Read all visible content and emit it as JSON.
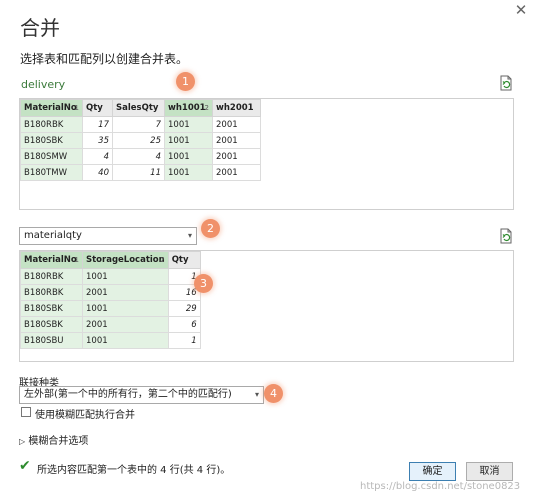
{
  "dialog": {
    "title": "合并",
    "subtitle": "选择表和匹配列以创建合并表。",
    "close_icon": "close-icon"
  },
  "table1": {
    "name": "delivery",
    "columns": [
      {
        "name": "MaterialNo",
        "index": "1"
      },
      {
        "name": "Qty",
        "index": ""
      },
      {
        "name": "SalesQty",
        "index": ""
      },
      {
        "name": "wh1001",
        "index": "2"
      },
      {
        "name": "wh2001",
        "index": ""
      }
    ],
    "rows": [
      [
        "B180RBK",
        "17",
        "7",
        "1001",
        "2001"
      ],
      [
        "B180SBK",
        "35",
        "25",
        "1001",
        "2001"
      ],
      [
        "B180SMW",
        "4",
        "4",
        "1001",
        "2001"
      ],
      [
        "B180TMW",
        "40",
        "11",
        "1001",
        "2001"
      ]
    ]
  },
  "table2": {
    "selected": "materialqty",
    "columns": [
      {
        "name": "MaterialNo",
        "index": "1"
      },
      {
        "name": "StorageLocation",
        "index": "2"
      },
      {
        "name": "Qty",
        "index": ""
      }
    ],
    "rows": [
      [
        "B180RBK",
        "1001",
        "1"
      ],
      [
        "B180RBK",
        "2001",
        "16"
      ],
      [
        "B180SBK",
        "1001",
        "29"
      ],
      [
        "B180SBK",
        "2001",
        "6"
      ],
      [
        "B180SBU",
        "1001",
        "1"
      ]
    ]
  },
  "join": {
    "label": "联接种类",
    "selected": "左外部(第一个中的所有行，第二个中的匹配行)",
    "fuzzy_label": "使用模糊匹配执行合并",
    "fuzzy_checked": false,
    "fuzzy_options_label": "模糊合并选项"
  },
  "status": {
    "text": "所选内容匹配第一个表中的 4 行(共 4 行)。"
  },
  "buttons": {
    "ok": "确定",
    "cancel": "取消"
  },
  "badges": [
    "1",
    "2",
    "3",
    "4"
  ],
  "watermark": "https://blog.csdn.net/stone0823",
  "colors": {
    "accent_green": "#3a7a3a",
    "selected_header": "#c4e2c4",
    "selected_cell": "#e3f2e3",
    "badge": "#f0916a",
    "primary_border": "#3c7fb1"
  }
}
